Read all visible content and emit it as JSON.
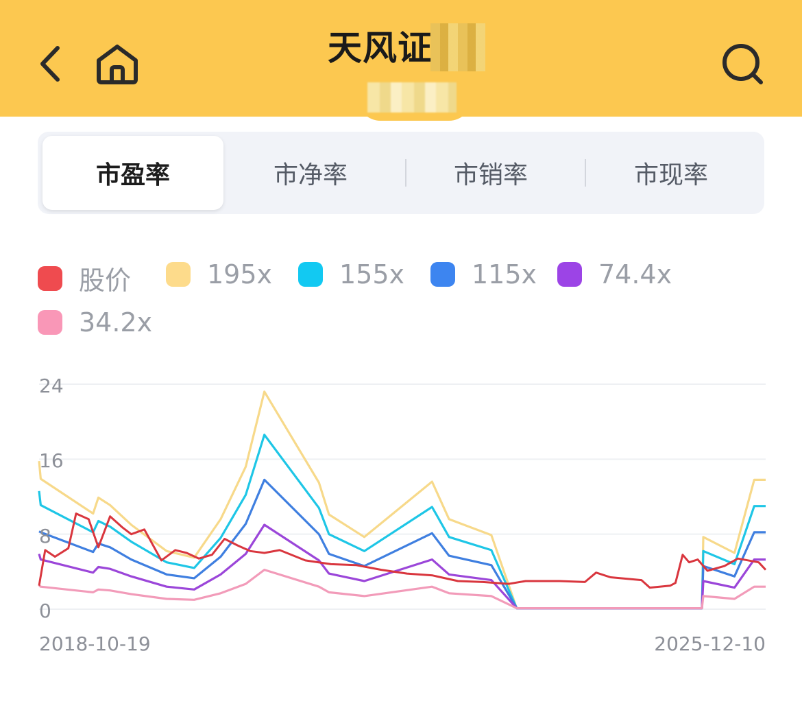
{
  "header": {
    "title": "天风证",
    "back_icon": "chevron-left-icon",
    "home_icon": "home-icon",
    "search_icon": "search-icon"
  },
  "colors": {
    "header_bg": "#fcc850",
    "price": "#d9363e",
    "band_195": "#f7d98a",
    "band_155": "#1ec6e6",
    "band_115": "#3f7fe0",
    "band_74_4": "#9b46d9",
    "band_34_2": "#f29bb9"
  },
  "tabs": [
    {
      "label": "市盈率",
      "active": true
    },
    {
      "label": "市净率",
      "active": false
    },
    {
      "label": "市销率",
      "active": false
    },
    {
      "label": "市现率",
      "active": false
    }
  ],
  "legend": [
    {
      "label": "股价",
      "color": "#ef4b4f"
    },
    {
      "label": "195x",
      "color": "#fddb8b"
    },
    {
      "label": "155x",
      "color": "#12c9f2"
    },
    {
      "label": "115x",
      "color": "#3d85f0"
    },
    {
      "label": "74.4x",
      "color": "#9c44e6"
    },
    {
      "label": "34.2x",
      "color": "#f997b7"
    }
  ],
  "chart_data": {
    "type": "line",
    "y_ticks": [
      "24",
      "16",
      "8",
      "0"
    ],
    "ylim": [
      0,
      24
    ],
    "x_start_label": "2018-10-19",
    "x_end_label": "2025-12-10",
    "x_range": [
      "2018-10-19",
      "2025-12-10"
    ],
    "grid": true,
    "legend_position": "top",
    "series": [
      {
        "name": "195x",
        "color": "#f7d98a",
        "points": [
          [
            "2018-10-19",
            15.8
          ],
          [
            "2018-10-25",
            13.9
          ],
          [
            "2019-05-01",
            10.2
          ],
          [
            "2019-05-20",
            11.9
          ],
          [
            "2019-07-01",
            11.1
          ],
          [
            "2019-09-15",
            9.0
          ],
          [
            "2020-01-20",
            6.2
          ],
          [
            "2020-04-28",
            5.5
          ],
          [
            "2020-08-01",
            9.6
          ],
          [
            "2020-10-30",
            15.2
          ],
          [
            "2021-01-05",
            23.2
          ],
          [
            "2021-07-20",
            13.5
          ],
          [
            "2021-08-25",
            10.1
          ],
          [
            "2021-12-30",
            7.7
          ],
          [
            "2022-08-30",
            13.6
          ],
          [
            "2022-10-30",
            9.6
          ],
          [
            "2023-03-31",
            7.9
          ],
          [
            "2023-06-30",
            0.1
          ],
          [
            "2025-04-25",
            0.1
          ],
          [
            "2025-04-30",
            7.7
          ],
          [
            "2025-08-20",
            6.0
          ],
          [
            "2025-10-30",
            13.8
          ],
          [
            "2025-12-10",
            13.8
          ]
        ]
      },
      {
        "name": "155x",
        "color": "#1ec6e6",
        "points": [
          [
            "2018-10-19",
            12.6
          ],
          [
            "2018-10-25",
            11.1
          ],
          [
            "2019-05-01",
            8.2
          ],
          [
            "2019-05-20",
            9.4
          ],
          [
            "2019-07-01",
            8.8
          ],
          [
            "2019-09-15",
            7.2
          ],
          [
            "2020-01-20",
            5.0
          ],
          [
            "2020-04-28",
            4.4
          ],
          [
            "2020-08-01",
            7.6
          ],
          [
            "2020-10-30",
            12.2
          ],
          [
            "2021-01-05",
            18.6
          ],
          [
            "2021-07-20",
            10.8
          ],
          [
            "2021-08-25",
            8.0
          ],
          [
            "2021-12-30",
            6.2
          ],
          [
            "2022-08-30",
            10.9
          ],
          [
            "2022-10-30",
            7.7
          ],
          [
            "2023-03-31",
            6.3
          ],
          [
            "2023-06-30",
            0.1
          ],
          [
            "2025-04-25",
            0.1
          ],
          [
            "2025-04-30",
            6.2
          ],
          [
            "2025-08-20",
            4.8
          ],
          [
            "2025-10-30",
            11.0
          ],
          [
            "2025-12-10",
            11.0
          ]
        ]
      },
      {
        "name": "115x",
        "color": "#3f7fe0",
        "points": [
          [
            "2018-10-19",
            8.3
          ],
          [
            "2018-10-25",
            8.2
          ],
          [
            "2019-05-01",
            6.1
          ],
          [
            "2019-05-20",
            7.0
          ],
          [
            "2019-07-01",
            6.6
          ],
          [
            "2019-09-15",
            5.3
          ],
          [
            "2020-01-20",
            3.7
          ],
          [
            "2020-04-28",
            3.3
          ],
          [
            "2020-08-01",
            5.6
          ],
          [
            "2020-10-30",
            9.1
          ],
          [
            "2021-01-05",
            13.8
          ],
          [
            "2021-07-20",
            8.0
          ],
          [
            "2021-08-25",
            5.9
          ],
          [
            "2021-12-30",
            4.6
          ],
          [
            "2022-08-30",
            8.1
          ],
          [
            "2022-10-30",
            5.7
          ],
          [
            "2023-03-31",
            4.7
          ],
          [
            "2023-06-30",
            0.1
          ],
          [
            "2025-04-25",
            0.1
          ],
          [
            "2025-04-30",
            4.6
          ],
          [
            "2025-08-20",
            3.5
          ],
          [
            "2025-10-30",
            8.2
          ],
          [
            "2025-12-10",
            8.2
          ]
        ]
      },
      {
        "name": "74.4x",
        "color": "#9b46d9",
        "points": [
          [
            "2018-10-19",
            5.9
          ],
          [
            "2018-10-25",
            5.3
          ],
          [
            "2019-05-01",
            3.9
          ],
          [
            "2019-05-20",
            4.5
          ],
          [
            "2019-07-01",
            4.3
          ],
          [
            "2019-09-15",
            3.5
          ],
          [
            "2020-01-20",
            2.4
          ],
          [
            "2020-04-28",
            2.1
          ],
          [
            "2020-08-01",
            3.7
          ],
          [
            "2020-10-30",
            5.9
          ],
          [
            "2021-01-05",
            9.0
          ],
          [
            "2021-07-20",
            5.2
          ],
          [
            "2021-08-25",
            3.8
          ],
          [
            "2021-12-30",
            3.0
          ],
          [
            "2022-08-30",
            5.3
          ],
          [
            "2022-10-30",
            3.7
          ],
          [
            "2023-03-31",
            3.1
          ],
          [
            "2023-06-30",
            0.1
          ],
          [
            "2025-04-25",
            0.1
          ],
          [
            "2025-04-30",
            3.0
          ],
          [
            "2025-08-20",
            2.3
          ],
          [
            "2025-10-30",
            5.3
          ],
          [
            "2025-12-10",
            5.3
          ]
        ]
      },
      {
        "name": "34.2x",
        "color": "#f29bb9",
        "points": [
          [
            "2018-10-19",
            2.5
          ],
          [
            "2018-10-25",
            2.4
          ],
          [
            "2019-05-01",
            1.8
          ],
          [
            "2019-05-20",
            2.1
          ],
          [
            "2019-07-01",
            2.0
          ],
          [
            "2019-09-15",
            1.6
          ],
          [
            "2020-01-20",
            1.1
          ],
          [
            "2020-04-28",
            1.0
          ],
          [
            "2020-08-01",
            1.7
          ],
          [
            "2020-10-30",
            2.7
          ],
          [
            "2021-01-05",
            4.2
          ],
          [
            "2021-07-20",
            2.4
          ],
          [
            "2021-08-25",
            1.8
          ],
          [
            "2021-12-30",
            1.4
          ],
          [
            "2022-08-30",
            2.4
          ],
          [
            "2022-10-30",
            1.7
          ],
          [
            "2023-03-31",
            1.4
          ],
          [
            "2023-06-30",
            0.1
          ],
          [
            "2025-04-25",
            0.1
          ],
          [
            "2025-04-30",
            1.4
          ],
          [
            "2025-08-20",
            1.1
          ],
          [
            "2025-10-30",
            2.4
          ],
          [
            "2025-12-10",
            2.4
          ]
        ]
      },
      {
        "name": "股价",
        "color": "#d9363e",
        "points": [
          [
            "2018-10-19",
            2.5
          ],
          [
            "2018-11-10",
            6.3
          ],
          [
            "2018-12-15",
            5.6
          ],
          [
            "2019-02-01",
            6.5
          ],
          [
            "2019-03-01",
            10.2
          ],
          [
            "2019-04-15",
            9.6
          ],
          [
            "2019-05-20",
            6.6
          ],
          [
            "2019-07-01",
            9.9
          ],
          [
            "2019-08-15",
            8.7
          ],
          [
            "2019-09-15",
            8.0
          ],
          [
            "2019-11-01",
            8.5
          ],
          [
            "2020-01-01",
            5.2
          ],
          [
            "2020-02-20",
            6.3
          ],
          [
            "2020-04-01",
            6.0
          ],
          [
            "2020-05-15",
            5.4
          ],
          [
            "2020-07-01",
            5.8
          ],
          [
            "2020-08-15",
            7.5
          ],
          [
            "2020-10-01",
            6.8
          ],
          [
            "2020-11-15",
            6.2
          ],
          [
            "2021-01-05",
            6.0
          ],
          [
            "2021-03-01",
            6.3
          ],
          [
            "2021-06-01",
            5.2
          ],
          [
            "2021-09-01",
            4.8
          ],
          [
            "2021-12-01",
            4.7
          ],
          [
            "2022-03-01",
            4.2
          ],
          [
            "2022-06-01",
            3.8
          ],
          [
            "2022-09-01",
            3.6
          ],
          [
            "2022-12-01",
            3.0
          ],
          [
            "2023-03-01",
            2.9
          ],
          [
            "2023-06-01",
            2.7
          ],
          [
            "2023-08-01",
            3.0
          ],
          [
            "2023-12-01",
            3.0
          ],
          [
            "2024-03-01",
            2.9
          ],
          [
            "2024-04-10",
            3.9
          ],
          [
            "2024-06-01",
            3.4
          ],
          [
            "2024-09-20",
            3.1
          ],
          [
            "2024-10-20",
            2.3
          ],
          [
            "2025-01-01",
            2.5
          ],
          [
            "2025-01-20",
            2.8
          ],
          [
            "2025-02-15",
            5.8
          ],
          [
            "2025-03-10",
            5.0
          ],
          [
            "2025-04-10",
            5.3
          ],
          [
            "2025-05-15",
            4.1
          ],
          [
            "2025-07-15",
            4.6
          ],
          [
            "2025-09-01",
            5.4
          ],
          [
            "2025-11-15",
            5.0
          ],
          [
            "2025-12-10",
            4.2
          ]
        ]
      }
    ]
  }
}
